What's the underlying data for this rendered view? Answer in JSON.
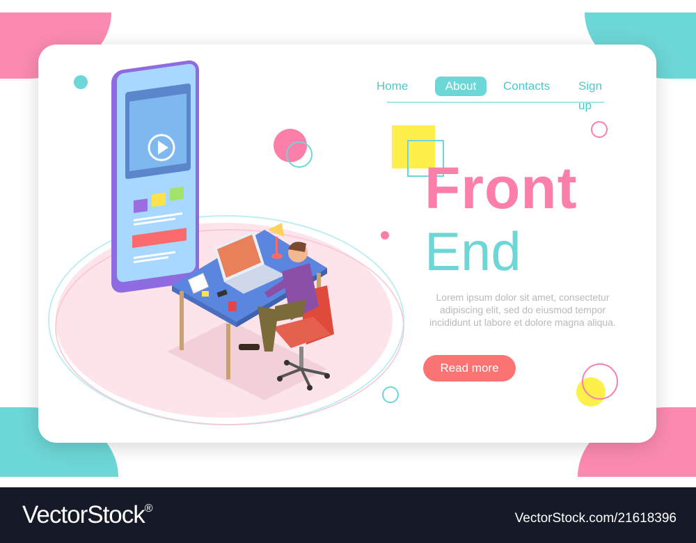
{
  "nav": {
    "items": [
      {
        "label": "Home"
      },
      {
        "label": "About",
        "active": true
      },
      {
        "label": "Contacts"
      },
      {
        "label": "Sign up"
      }
    ]
  },
  "hero": {
    "title_line1": "Front",
    "title_line2": "End",
    "description": "Lorem ipsum dolor sit amet, consectetur adipiscing elit, sed do eiusmod tempor incididunt ut labore et dolore magna aliqua.",
    "cta_label": "Read more"
  },
  "footer": {
    "brand": "VectorStock",
    "brand_mark": "®",
    "image_id": "VectorStock.com/21618396"
  },
  "colors": {
    "pink": "#fb7fa8",
    "teal": "#6dd6d6",
    "yellow": "#fdf04b",
    "cta": "#fb7373",
    "footer_bg": "#161a28"
  },
  "icons": [
    "play-icon"
  ]
}
